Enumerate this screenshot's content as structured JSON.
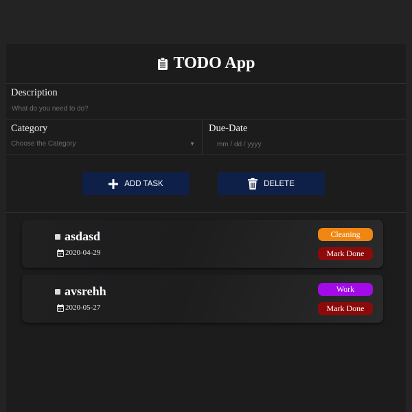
{
  "app": {
    "title": "TODO App"
  },
  "form": {
    "description_label": "Description",
    "description_placeholder": "What do you need to do?",
    "category_label": "Category",
    "category_placeholder": "Choose the Category",
    "due_label": "Due-Date",
    "due_placeholder": "mm / dd / yyyy"
  },
  "buttons": {
    "add_label": "ADD TASK",
    "delete_label": "DELETE"
  },
  "tasks": [
    {
      "name": "asdasd",
      "date": "2020-04-29",
      "category": "Cleaning",
      "category_color": "#f08612",
      "action": "Mark Done"
    },
    {
      "name": "avsrehh",
      "date": "2020-05-27",
      "category": "Work",
      "category_color": "#a30ae8",
      "action": "Mark Done"
    }
  ],
  "colors": {
    "background": "#242324",
    "panel": "#1c1c1d",
    "button": "#0f2048",
    "mark_done": "#8d0a0a"
  }
}
